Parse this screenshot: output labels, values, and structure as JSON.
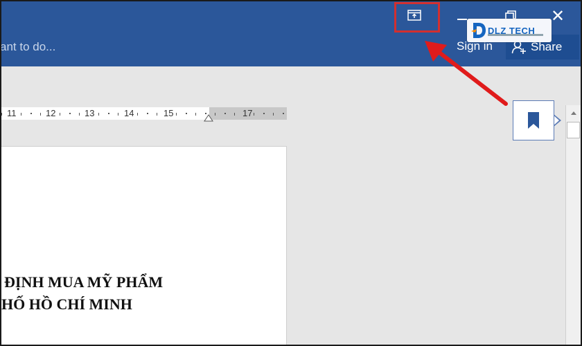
{
  "titlebar": {
    "tell_me_text": "ant to do...",
    "sign_in_label": "Sign in",
    "share_label": "Share",
    "window_controls": [
      "minimize-icon",
      "restore-icon",
      "close-icon"
    ],
    "close_glyph": "✕"
  },
  "logo": {
    "text": "DLZ TECH"
  },
  "ruler": {
    "labels": [
      "11",
      "12",
      "13",
      "14",
      "15",
      "17"
    ]
  },
  "document": {
    "line1": "ĐỊNH MUA MỸ PHẨM",
    "line2": "HỐ HỒ CHÍ MINH"
  },
  "colors": {
    "titlebar": "#2b579a",
    "highlight": "#d32f2f",
    "canvas": "#e6e6e6",
    "bookmark": "#2b579a"
  },
  "icons": {
    "ribbon_display": "ribbon-display-options-icon",
    "share": "share-person-icon",
    "bookmark": "bookmark-icon",
    "scroll_up": "scroll-up-arrow-icon"
  }
}
